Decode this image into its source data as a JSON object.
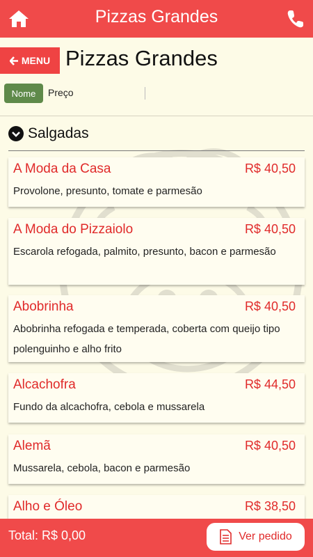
{
  "topbar": {
    "title": "Pizzas Grandes",
    "home_icon": "home-icon",
    "phone_icon": "phone-icon"
  },
  "header": {
    "menu_label": "MENU",
    "title": "Pizzas Grandes"
  },
  "sort": {
    "name_label": "Nome",
    "price_label": "Preço",
    "active": "Nome"
  },
  "section": {
    "label": "Salgadas"
  },
  "items": [
    {
      "name": "A Moda da Casa",
      "price": "R$ 40,50",
      "description": "Provolone, presunto, tomate e parmesão"
    },
    {
      "name": "A Moda do Pizzaiolo",
      "price": "R$ 40,50",
      "description": "Escarola refogada, palmito, presunto, bacon e parmesão"
    },
    {
      "name": "Abobrinha",
      "price": "R$ 40,50",
      "description": "Abobrinha refogada e temperada, coberta com queijo tipo polenguinho e alho frito"
    },
    {
      "name": "Alcachofra",
      "price": "R$ 44,50",
      "description": "Fundo da alcachofra, cebola e mussarela"
    },
    {
      "name": "Alemã",
      "price": "R$ 40,50",
      "description": "Mussarela, cebola, bacon e parmesão"
    },
    {
      "name": "Alho e Óleo",
      "price": "R$ 38,50",
      "description": ""
    }
  ],
  "footer": {
    "total": "Total: R$ 0,00",
    "order_label": "Ver pedido"
  },
  "colors": {
    "accent": "#f04a4a",
    "sort_active": "#5f8a4a",
    "background": "#fdfbe7"
  }
}
